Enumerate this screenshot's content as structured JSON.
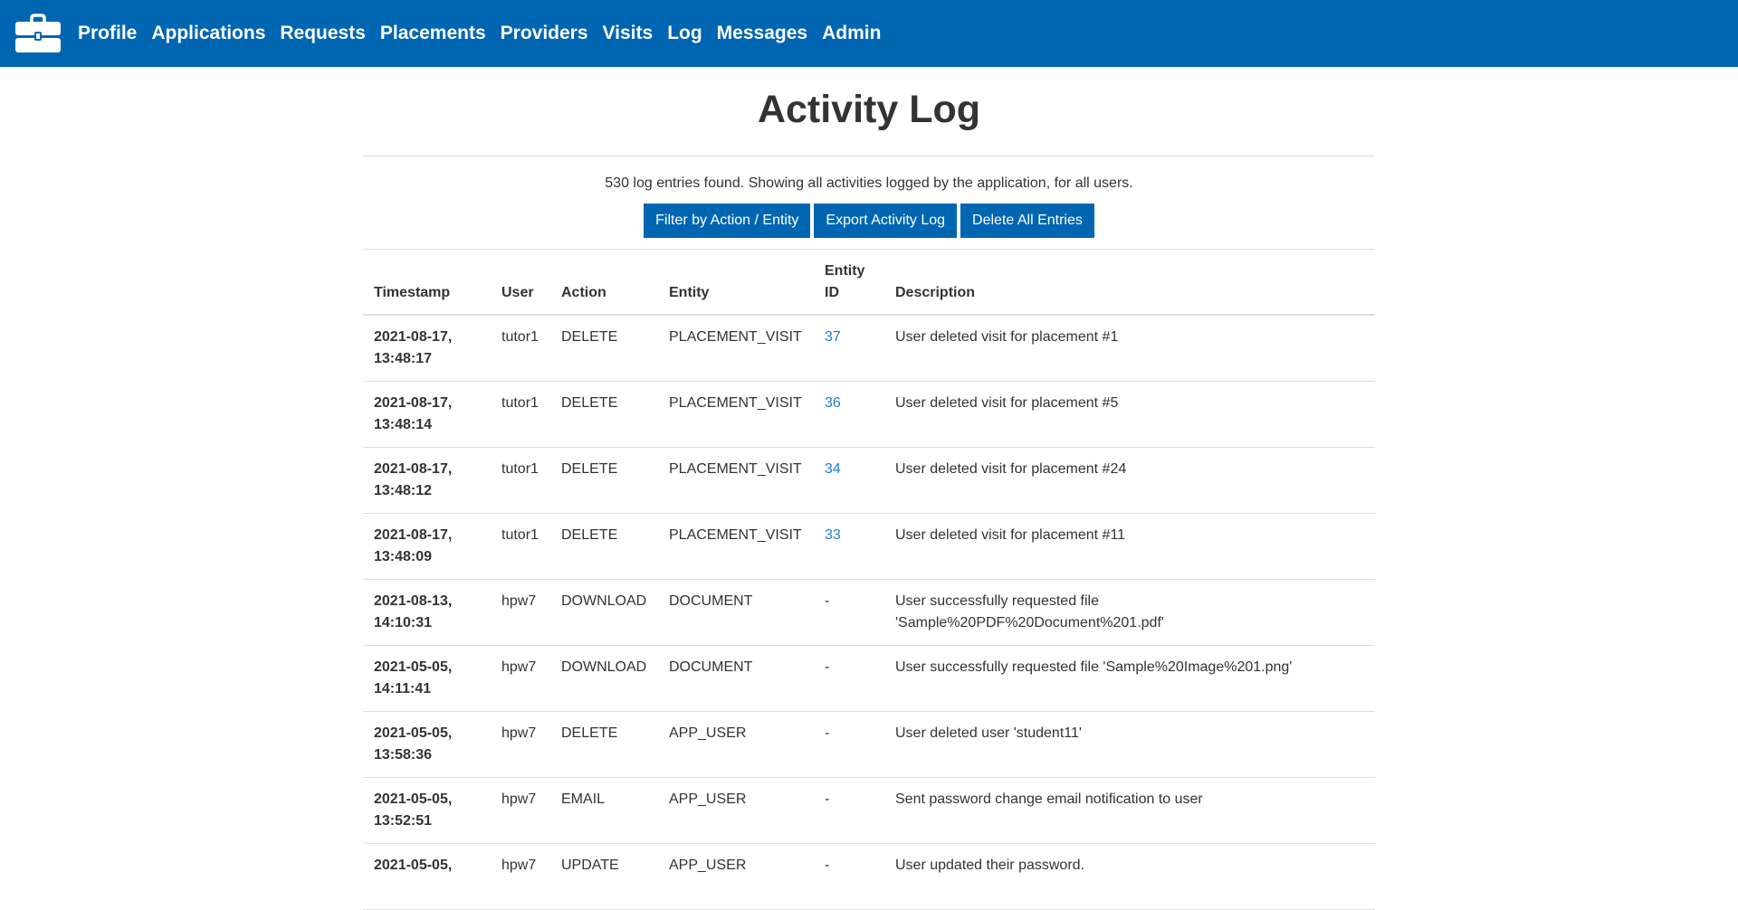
{
  "nav": {
    "brand_icon": "briefcase-icon",
    "items": [
      {
        "label": "Profile"
      },
      {
        "label": "Applications"
      },
      {
        "label": "Requests"
      },
      {
        "label": "Placements"
      },
      {
        "label": "Providers"
      },
      {
        "label": "Visits"
      },
      {
        "label": "Log"
      },
      {
        "label": "Messages"
      },
      {
        "label": "Admin"
      }
    ]
  },
  "page": {
    "title": "Activity Log",
    "summary": "530 log entries found. Showing all activities logged by the application, for all users."
  },
  "buttons": {
    "filter": "Filter by Action / Entity",
    "export": "Export Activity Log",
    "delete_all": "Delete All Entries"
  },
  "table": {
    "headers": {
      "timestamp": "Timestamp",
      "user": "User",
      "action": "Action",
      "entity": "Entity",
      "entity_id_line1": "Entity",
      "entity_id_line2": "ID",
      "description": "Description"
    },
    "rows": [
      {
        "date": "2021-08-17,",
        "time": "13:48:17",
        "user": "tutor1",
        "action": "DELETE",
        "entity": "PLACEMENT_VISIT",
        "entity_id": "37",
        "description": "User deleted visit for placement #1"
      },
      {
        "date": "2021-08-17,",
        "time": "13:48:14",
        "user": "tutor1",
        "action": "DELETE",
        "entity": "PLACEMENT_VISIT",
        "entity_id": "36",
        "description": "User deleted visit for placement #5"
      },
      {
        "date": "2021-08-17,",
        "time": "13:48:12",
        "user": "tutor1",
        "action": "DELETE",
        "entity": "PLACEMENT_VISIT",
        "entity_id": "34",
        "description": "User deleted visit for placement #24"
      },
      {
        "date": "2021-08-17,",
        "time": "13:48:09",
        "user": "tutor1",
        "action": "DELETE",
        "entity": "PLACEMENT_VISIT",
        "entity_id": "33",
        "description": "User deleted visit for placement #11"
      },
      {
        "date": "2021-08-13,",
        "time": "14:10:31",
        "user": "hpw7",
        "action": "DOWNLOAD",
        "entity": "DOCUMENT",
        "entity_id": "-",
        "description": "User successfully requested file 'Sample%20PDF%20Document%201.pdf'"
      },
      {
        "date": "2021-05-05,",
        "time": "14:11:41",
        "user": "hpw7",
        "action": "DOWNLOAD",
        "entity": "DOCUMENT",
        "entity_id": "-",
        "description": "User successfully requested file 'Sample%20Image%201.png'"
      },
      {
        "date": "2021-05-05,",
        "time": "13:58:36",
        "user": "hpw7",
        "action": "DELETE",
        "entity": "APP_USER",
        "entity_id": "-",
        "description": "User deleted user 'student11'"
      },
      {
        "date": "2021-05-05,",
        "time": "13:52:51",
        "user": "hpw7",
        "action": "EMAIL",
        "entity": "APP_USER",
        "entity_id": "-",
        "description": "Sent password change email notification to user"
      },
      {
        "date": "2021-05-05,",
        "time": "",
        "user": "hpw7",
        "action": "UPDATE",
        "entity": "APP_USER",
        "entity_id": "-",
        "description": "User updated their password."
      }
    ]
  },
  "colors": {
    "navbar": "#0066b2",
    "button": "#0066b2",
    "link": "#1a7ed6"
  }
}
